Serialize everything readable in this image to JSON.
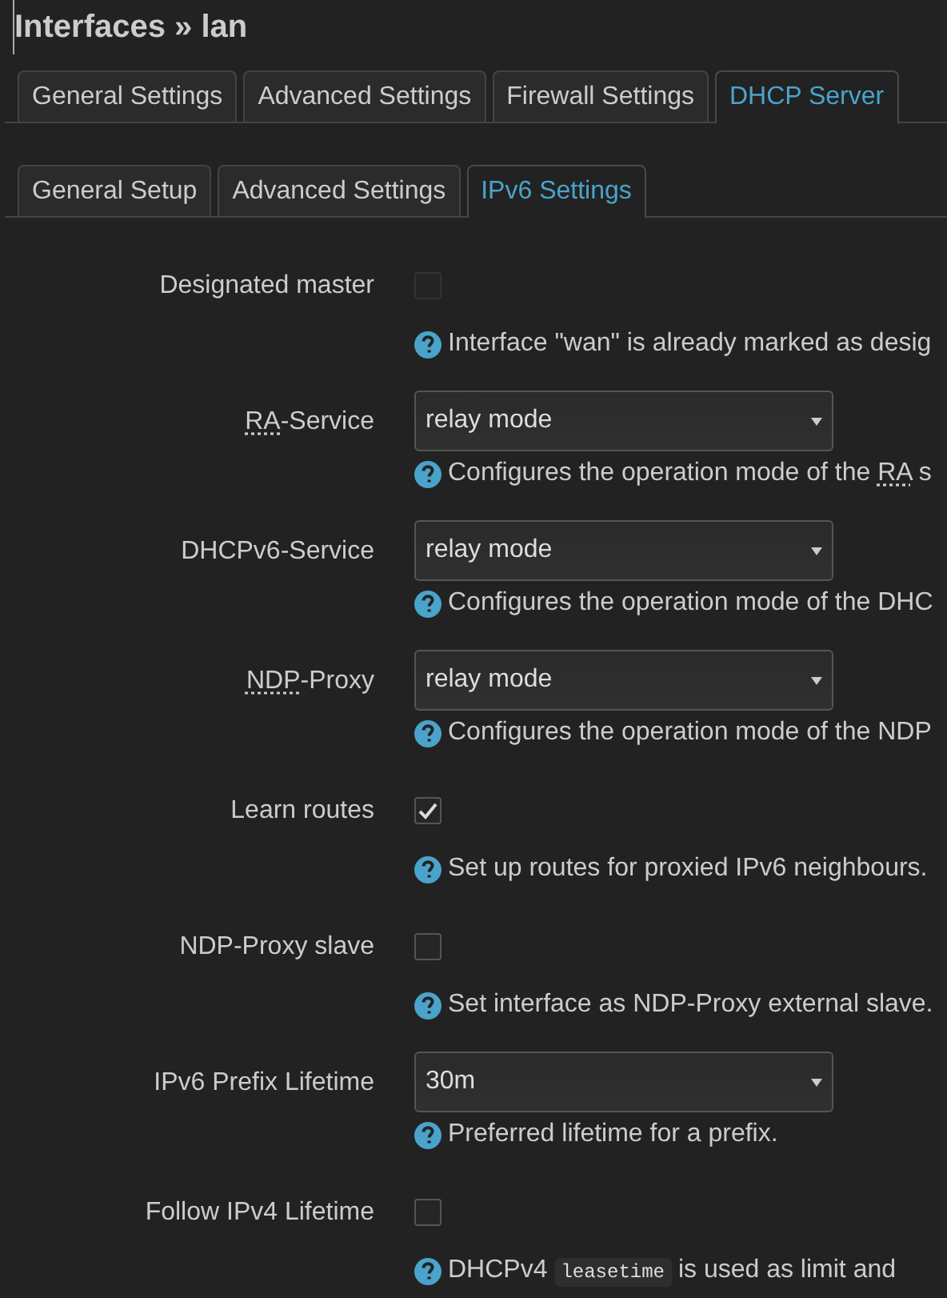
{
  "title": "Interfaces » lan",
  "tabs": [
    {
      "label": "General Settings",
      "selected": false
    },
    {
      "label": "Advanced Settings",
      "selected": false
    },
    {
      "label": "Firewall Settings",
      "selected": false
    },
    {
      "label": "DHCP Server",
      "selected": true
    }
  ],
  "subtabs": [
    {
      "label": "General Setup",
      "selected": false
    },
    {
      "label": "Advanced Settings",
      "selected": false
    },
    {
      "label": "IPv6 Settings",
      "selected": true
    }
  ],
  "fields": [
    {
      "kind": "checkbox",
      "label": [
        {
          "kind": "plain",
          "text": "Designated master"
        }
      ],
      "checked": false,
      "disabled": true,
      "help": [
        {
          "kind": "plain",
          "text": "Interface \"wan\" is already marked as desig"
        }
      ]
    },
    {
      "kind": "select",
      "label": [
        {
          "kind": "abbr",
          "text": "RA"
        },
        {
          "kind": "plain",
          "text": "-Service"
        }
      ],
      "value": "relay mode",
      "help": [
        {
          "kind": "plain",
          "text": "Configures the operation mode of the "
        },
        {
          "kind": "abbr",
          "text": "RA"
        },
        {
          "kind": "plain",
          "text": " s"
        }
      ]
    },
    {
      "kind": "select",
      "label": [
        {
          "kind": "plain",
          "text": "DHCPv6-Service"
        }
      ],
      "value": "relay mode",
      "help": [
        {
          "kind": "plain",
          "text": "Configures the operation mode of the DHC"
        }
      ]
    },
    {
      "kind": "select",
      "label": [
        {
          "kind": "abbr",
          "text": "NDP"
        },
        {
          "kind": "plain",
          "text": "-Proxy"
        }
      ],
      "value": "relay mode",
      "help": [
        {
          "kind": "plain",
          "text": "Configures the operation mode of the NDP"
        }
      ]
    },
    {
      "kind": "checkbox",
      "label": [
        {
          "kind": "plain",
          "text": "Learn routes"
        }
      ],
      "checked": true,
      "disabled": false,
      "help": [
        {
          "kind": "plain",
          "text": "Set up routes for proxied IPv6 neighbours."
        }
      ]
    },
    {
      "kind": "checkbox",
      "label": [
        {
          "kind": "plain",
          "text": "NDP-Proxy slave"
        }
      ],
      "checked": false,
      "disabled": false,
      "help": [
        {
          "kind": "plain",
          "text": "Set interface as NDP-Proxy external slave."
        }
      ]
    },
    {
      "kind": "select",
      "label": [
        {
          "kind": "plain",
          "text": "IPv6 Prefix Lifetime"
        }
      ],
      "value": "30m",
      "help": [
        {
          "kind": "plain",
          "text": "Preferred lifetime for a prefix."
        }
      ]
    },
    {
      "kind": "checkbox",
      "label": [
        {
          "kind": "plain",
          "text": "Follow IPv4 Lifetime"
        }
      ],
      "checked": false,
      "disabled": false,
      "help": [
        {
          "kind": "plain",
          "text": "DHCPv4 "
        },
        {
          "kind": "code",
          "text": "leasetime"
        },
        {
          "kind": "plain",
          "text": " is used as limit and"
        }
      ]
    }
  ]
}
